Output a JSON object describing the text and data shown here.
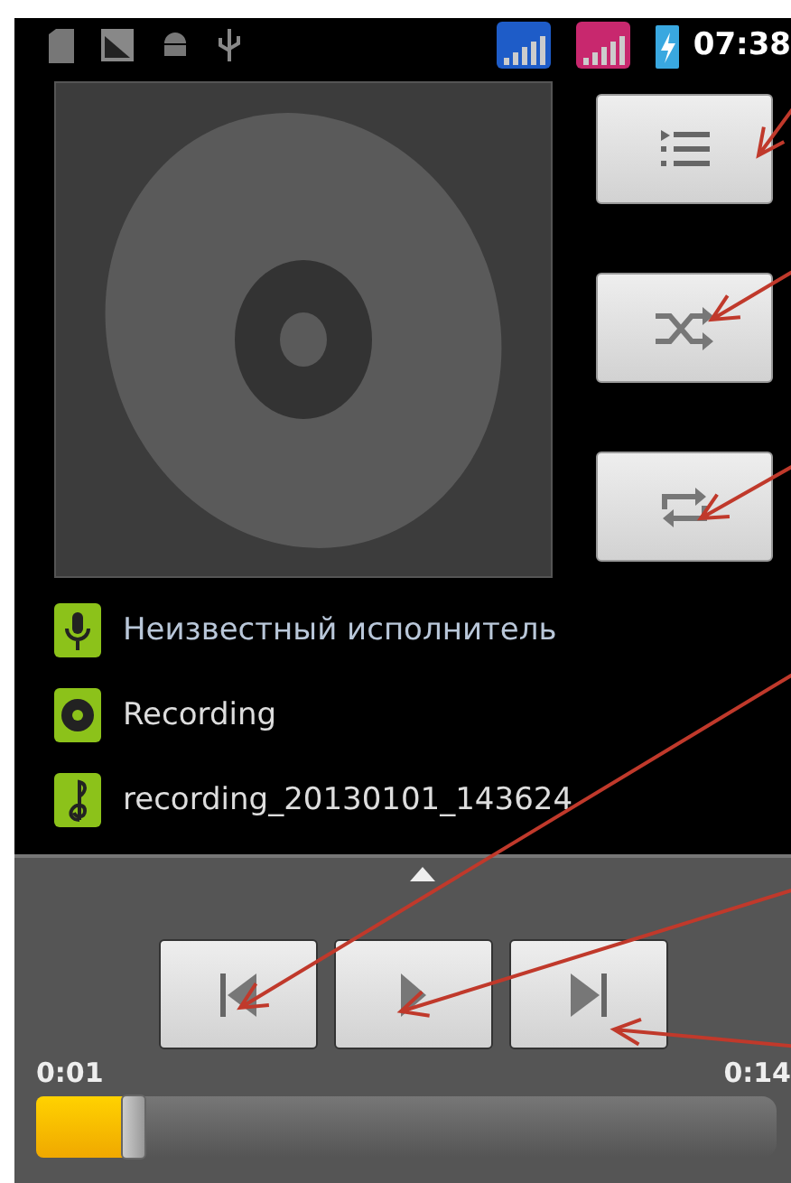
{
  "status_bar": {
    "time": "07:38"
  },
  "side_buttons": [
    {
      "kind": "playlist"
    },
    {
      "kind": "shuffle"
    },
    {
      "kind": "repeat"
    }
  ],
  "track_info": [
    {
      "kind": "artist",
      "text": "Неизвестный исполнитель"
    },
    {
      "kind": "album",
      "text": "Recording"
    },
    {
      "kind": "track",
      "text": "recording_20130101_143624"
    }
  ],
  "transport": [
    {
      "kind": "previous"
    },
    {
      "kind": "play"
    },
    {
      "kind": "next"
    }
  ],
  "progress": {
    "elapsed": "0:01",
    "total": "0:14",
    "level": 0.12
  }
}
